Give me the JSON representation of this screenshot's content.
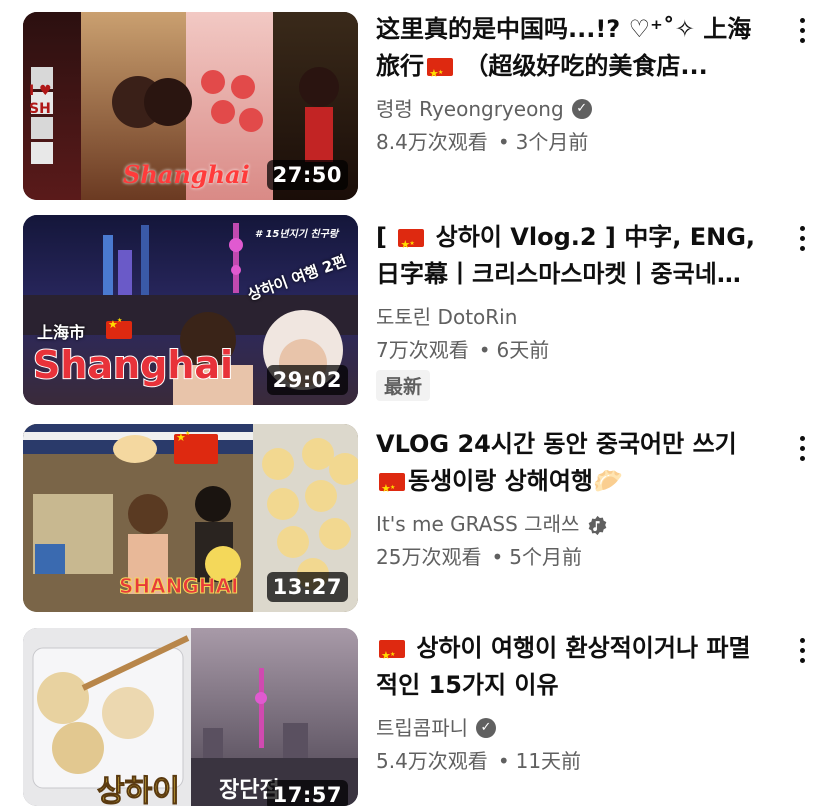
{
  "videos": [
    {
      "title_pre": "这里真的是中国吗...!? ♡⁺˚✧ 上海旅行",
      "title_post": " （超级好吃的美食店...",
      "channel": "령령 Ryeongryeong",
      "views": "8.4万次观看",
      "age": "3个月前",
      "duration": "27:50",
      "thumb_caption": "Shanghai",
      "sign_text": "I ♥ SH"
    },
    {
      "title_pre": "[ ",
      "title_post": " 상하이 Vlog.2 ] 中字, ENG,日字幕丨크리스마스마켓丨중국네일...",
      "channel": "도토린 DotoRin",
      "views": "7万次观看",
      "age": "6天前",
      "badge": "最新",
      "duration": "29:02",
      "thumb_caption": "Shanghai",
      "thumb_city": "上海市",
      "thumb_episode": "상하이 여행 2편",
      "thumb_tag": "# 15년지기 친구랑"
    },
    {
      "title_pre": "VLOG 24시간 동안 중국어만 쓰기 ",
      "title_post": "동생이랑 상해여행🥟",
      "channel": "It's me GRASS 그래쓰",
      "views": "25万次观看",
      "age": "5个月前",
      "duration": "13:27",
      "thumb_caption": "SHANGHAI"
    },
    {
      "title_pre": "",
      "title_post": " 상하이 여행이 환상적이거나 파멸적인 15가지 이유",
      "channel": "트립콤파니",
      "views": "5.4万次观看",
      "age": "11天前",
      "duration": "17:57",
      "thumb_caption": "상하이",
      "thumb_caption2": "장단점"
    }
  ],
  "icons": {
    "verified": "check-circle-icon",
    "artist": "music-note-icon",
    "more": "more-vertical-icon",
    "flag": "china-flag-icon"
  },
  "colors": {
    "text_primary": "#0f0f0f",
    "text_secondary": "#606060",
    "flag_red": "#de2910",
    "flag_gold": "#ffde00"
  }
}
